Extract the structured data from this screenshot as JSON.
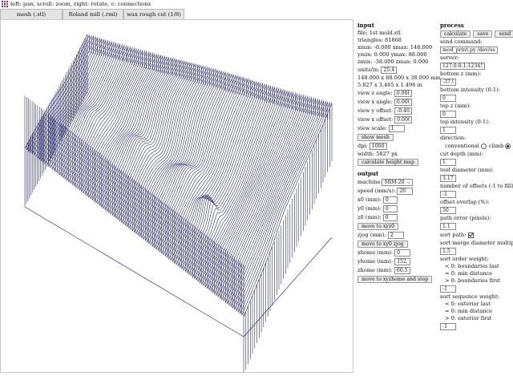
{
  "help_text": "left: pan, scroll: zoom, right: rotate, c: connections",
  "tabs": [
    {
      "label": "mesh (.stl)"
    },
    {
      "label": "Roland mill (.rml)"
    },
    {
      "label": "wax rough cut (1/8)"
    }
  ],
  "colors": {
    "toolpath": "#1a1a5c",
    "tab_bg": "#e4e4e4",
    "icon_blue": "#2b3fd6",
    "icon_red": "#d62b2b"
  },
  "input": {
    "title": "input",
    "file": "file: 1st mold.stl",
    "triangles": "triangles: 81868",
    "x": "xmin: -0.000 xmax: 148.000",
    "y": "ymin: 0.000 ymax: 88.000",
    "z": "zmin: -38.000 zmax: 0.000",
    "units_label": "units/in:",
    "units_value": "25.4",
    "size_mm": "148.000 x 88.000 x 38.000 mm",
    "size_in": "5.827 x 3.465 x 1.496 in",
    "view_z_label": "view z angle:",
    "view_z_value": "0.000",
    "view_x_label": "view x angle:",
    "view_x_value": "0.000",
    "view_yoff_label": "view y offset:",
    "view_yoff_value": "-0.405",
    "view_xoff_label": "view x offset:",
    "view_xoff_value": "0.000",
    "view_scale_label": "view scale:",
    "view_scale_value": "1",
    "show_mesh": "show mesh",
    "dpi_label": "dpi:",
    "dpi_value": "1000",
    "width": "width: 5827 px",
    "calc_height": "calculate height map"
  },
  "output": {
    "title": "output",
    "machine_label": "machine",
    "machine_value": "SRM-20",
    "speed_label": "speed (mm/s):",
    "speed_value": "20",
    "x0_label": "x0 (mm):",
    "x0_value": "0",
    "y0_label": "y0 (mm):",
    "y0_value": "0",
    "z0_label": "z0 (mm):",
    "z0_value": "0",
    "move_xyz0": "move to xyz0",
    "zjog_label": "zjog (mm):",
    "zjog_value": "2",
    "move_xy0": "move to xy0 zjog",
    "xhome_label": "xhome (mm):",
    "xhome_value": "0",
    "yhome_label": "yhome (mm):",
    "yhome_value": "152.4",
    "zhome_label": "zhome (mm):",
    "zhome_value": "60.5",
    "move_home": "move to xyzhome and stop"
  },
  "process": {
    "title": "process",
    "calculate": "calculate",
    "save": "save",
    "send": "send",
    "send_command_label": "send command:",
    "send_command_value": "mod_print.py /dev/usb",
    "server_label": "server:",
    "server_value": "127.0.0.1:12345",
    "bottom_z_label": "bottom z (mm):",
    "bottom_z_value": "-37.99",
    "bottom_int_label": "bottom intensity (0-1):",
    "bottom_int_value": "0",
    "top_z_label": "top z (mm):",
    "top_z_value": "0",
    "top_int_label": "top intensity (0-1):",
    "top_int_value": "1",
    "direction_label": "direction:",
    "conventional": "conventional",
    "climb": "climb",
    "cut_depth_label": "cut depth (mm):",
    "cut_depth_value": "1",
    "tool_diam_label": "tool diameter (mm):",
    "tool_diam_value": "3.175",
    "offsets_label": "number of offsets (-1 to fill):",
    "offsets_value": "-1",
    "overlap_label": "offset overlap (%):",
    "overlap_value": "50",
    "path_error_label": "path error (pixels):",
    "path_error_value": "1.1",
    "sort_path_label": "sort path:",
    "sort_merge_label": "sort merge diameter multiple:",
    "sort_merge_value": "1.5",
    "sort_order_label": "sort order weight:",
    "sort_order_1": "< 0: boundaries last",
    "sort_order_2": "= 0: min distance",
    "sort_order_3": "> 0: boundaries first",
    "sort_order_value": "-1",
    "sort_seq_label": "sort sequence weight:",
    "sort_seq_1": "< 0: exterior last",
    "sort_seq_2": "= 0: min distance",
    "sort_seq_3": "> 0: exterior first",
    "sort_seq_value": "-1"
  }
}
